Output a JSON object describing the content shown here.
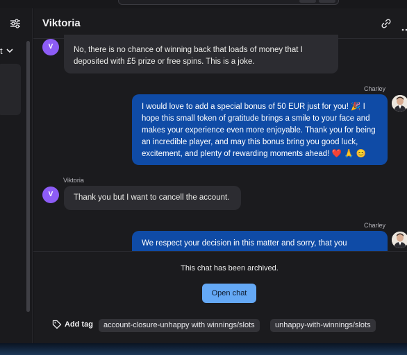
{
  "conversation": {
    "contact_name": "Viktoria",
    "contact_initial": "V"
  },
  "left_panel": {
    "dropdown_label": "t"
  },
  "messages": [
    {
      "sender": "",
      "direction": "incoming",
      "lines": [
        "No, there is no chance of winning back that loads of money that I",
        "deposited with £5 prize or free spins. This is a joke."
      ]
    },
    {
      "sender": "Charley",
      "direction": "outgoing",
      "lines": [
        "I would love to add a special bonus of 50 EUR just for you! 🎉 I",
        "hope this small token of gratitude brings a smile to your face and",
        "makes your experience even more enjoyable. Thank you for being",
        "an incredible player, and may this bonus bring you good luck,",
        "excitement, and plenty of rewarding moments ahead! ❤️ 🙏 😊"
      ]
    },
    {
      "sender": "Viktoria",
      "direction": "incoming",
      "lines": [
        "Thank you but I want to cancell the account."
      ]
    },
    {
      "sender": "Charley",
      "direction": "outgoing",
      "lines": [
        "We respect your decision in this matter and sorry, that you"
      ]
    }
  ],
  "footer": {
    "archived_notice": "This chat has been archived.",
    "open_chat_label": "Open chat",
    "add_tag_label": "Add tag",
    "tags": [
      "account-closure-unhappy with winnings/slots",
      "unhappy-with-winnings/slots"
    ]
  },
  "colors": {
    "accent_button": "#64a8f5",
    "outgoing_bubble": "#0f4ba6",
    "incoming_bubble": "#2c2c31",
    "avatar_purple": "#8d5cf6"
  },
  "icons": [
    "filter-sliders-icon",
    "chevron-down-icon",
    "link-icon",
    "more-horizontal-icon",
    "tag-icon"
  ]
}
